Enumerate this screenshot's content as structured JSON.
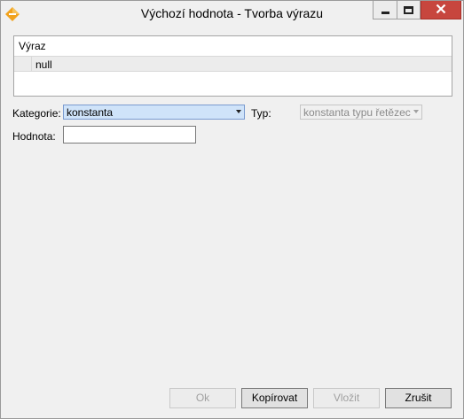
{
  "window": {
    "title": "Výchozí hodnota - Tvorba výrazu",
    "icon": "app-diamond-icon"
  },
  "controls": {
    "minimize": "minimize-icon",
    "maximize": "maximize-icon",
    "close": "close-icon"
  },
  "expression": {
    "header": "Výraz",
    "value": "null"
  },
  "form": {
    "category_label": "Kategorie:",
    "category_value": "konstanta",
    "type_label": "Typ:",
    "type_value": "konstanta typu řetězec",
    "value_label": "Hodnota:",
    "value_input": ""
  },
  "buttons": {
    "ok": "Ok",
    "copy": "Kopírovat",
    "insert": "Vložit",
    "cancel": "Zrušit"
  },
  "colors": {
    "close_button": "#c7463e",
    "combo_selected": "#cfe3f9",
    "app_icon": "#f1a21d"
  }
}
